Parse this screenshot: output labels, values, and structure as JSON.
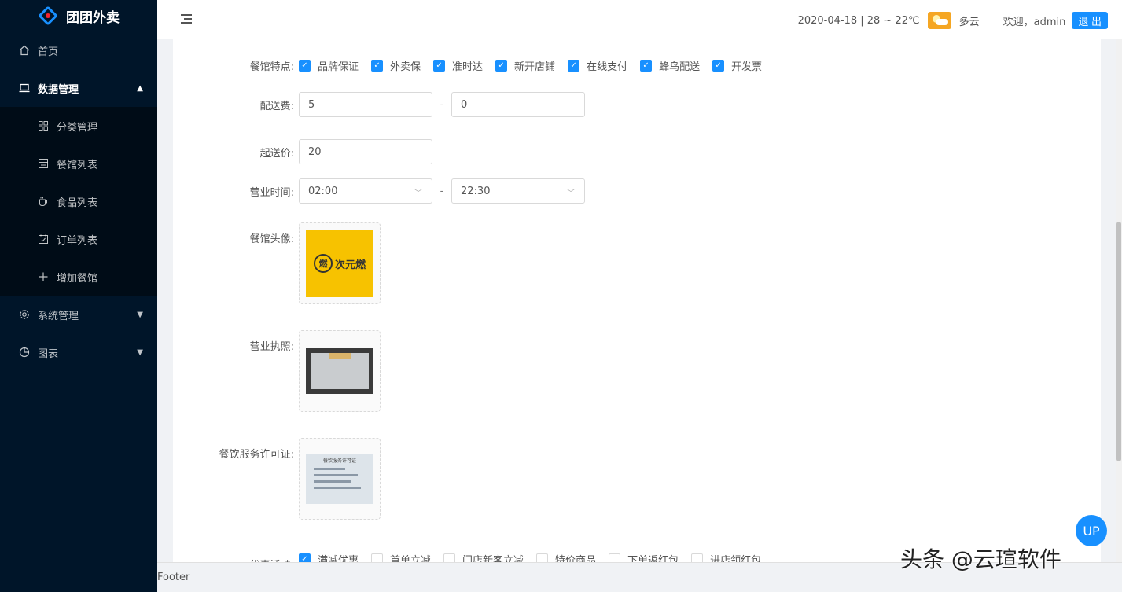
{
  "sidebar": {
    "logo_text": "团团外卖",
    "items": [
      {
        "label": "首页",
        "icon": "home-icon"
      },
      {
        "label": "数据管理",
        "icon": "laptop-icon",
        "expanded": true,
        "children": [
          {
            "label": "分类管理",
            "icon": "grid-icon"
          },
          {
            "label": "餐馆列表",
            "icon": "shop-icon"
          },
          {
            "label": "食品列表",
            "icon": "cup-icon"
          },
          {
            "label": "订单列表",
            "icon": "order-icon"
          },
          {
            "label": "增加餐馆",
            "icon": "plus-icon"
          }
        ]
      },
      {
        "label": "系统管理",
        "icon": "gear-icon"
      },
      {
        "label": "图表",
        "icon": "pie-chart-icon"
      }
    ]
  },
  "header": {
    "date_weather": "2020-04-18 | 28 ~ 22℃",
    "weather": "多云",
    "welcome": "欢迎，admin",
    "logout_label": "退 出"
  },
  "form": {
    "features": {
      "label": "餐馆特点:",
      "options": [
        {
          "label": "品牌保证",
          "checked": true
        },
        {
          "label": "外卖保",
          "checked": true
        },
        {
          "label": "准时达",
          "checked": true
        },
        {
          "label": "新开店铺",
          "checked": true
        },
        {
          "label": "在线支付",
          "checked": true
        },
        {
          "label": "蜂鸟配送",
          "checked": true
        },
        {
          "label": "开发票",
          "checked": true
        }
      ]
    },
    "delivery_fee": {
      "label": "配送费:",
      "from": "5",
      "sep": "-",
      "to": "0"
    },
    "min_price": {
      "label": "起送价:",
      "value": "20"
    },
    "hours": {
      "label": "营业时间:",
      "start": "02:00",
      "sep": "-",
      "end": "22:30"
    },
    "avatar": {
      "label": "餐馆头像:",
      "brand_text": "次元燃",
      "seal_text": "燃"
    },
    "license": {
      "label": "营业执照:"
    },
    "permit": {
      "label": "餐饮服务许可证:",
      "title_text": "餐饮服务许可证"
    },
    "promotions": {
      "label": "优惠活动:",
      "options": [
        {
          "label": "满减优惠",
          "checked": true
        },
        {
          "label": "首单立减",
          "checked": false
        },
        {
          "label": "门店新客立减",
          "checked": false
        },
        {
          "label": "特价商品",
          "checked": false
        },
        {
          "label": "下单返红包",
          "checked": false
        },
        {
          "label": "进店领红包",
          "checked": false
        }
      ]
    }
  },
  "footer": {
    "text": "Footer"
  },
  "up_button": "UP",
  "watermark": "头条 @云瑄软件",
  "colors": {
    "sidebar_bg": "#001529",
    "accent": "#1890ff",
    "weather_badge": "#f5a623"
  }
}
